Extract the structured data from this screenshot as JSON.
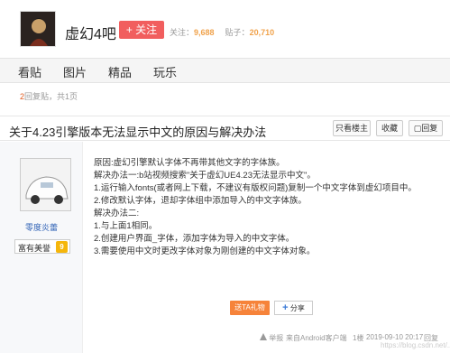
{
  "forum": {
    "name": "虚幻4吧",
    "follow_label": "+ 关注",
    "members_label": "关注：",
    "members_value": "9,688",
    "posts_label": "贴子：",
    "posts_value": "20,710"
  },
  "nav": {
    "items": [
      "看贴",
      "图片",
      "精品",
      "玩乐"
    ]
  },
  "thread_meta": {
    "reply_count": "2",
    "reply_suffix": "回复贴，共1页"
  },
  "thread": {
    "title": "关于4.23引擎版本无法显示中文的原因与解决办法",
    "only_op_label": "只看楼主",
    "collect_label": "收藏",
    "reply_label": "回复"
  },
  "author": {
    "name": "零度炎蕾",
    "badge_text": "富有美誉",
    "level": "9"
  },
  "post": {
    "lines": [
      "原因:虚幻引擎默认字体不再带其他文字的字体族。",
      "解决办法一:b站视频搜索\"关于虚幻UE4.23无法显示中文\"。",
      "1.运行输入fonts(或者网上下载，不建议有版权问题)复制一个中文字体到虚幻项目中。",
      "2.修改默认字体，退却字体组中添加导入的中文字体族。",
      "解决办法二:",
      "1.与上面1相同。",
      "2.创建用户界面_字体，添加字体为导入的中文字体。",
      "3.需要使用中文时更改字体对象为刚创建的中文字体对象。"
    ],
    "gift_label": "送TA礼物",
    "share_label": "分享"
  },
  "footer": {
    "report_label": "举报",
    "source_label": "来自Android客户端",
    "floor_label": "1楼",
    "timestamp": "2019-09-10 20:17",
    "reply_label": "回复"
  },
  "watermark": "https://blog.csdn.net/...",
  "colors": {
    "follow_bg": "#f15e5e",
    "stat_num": "#f0a24b",
    "author_link": "#3163b6",
    "gift_bg": "#f6833a",
    "level_badge": "#f5b60b"
  }
}
